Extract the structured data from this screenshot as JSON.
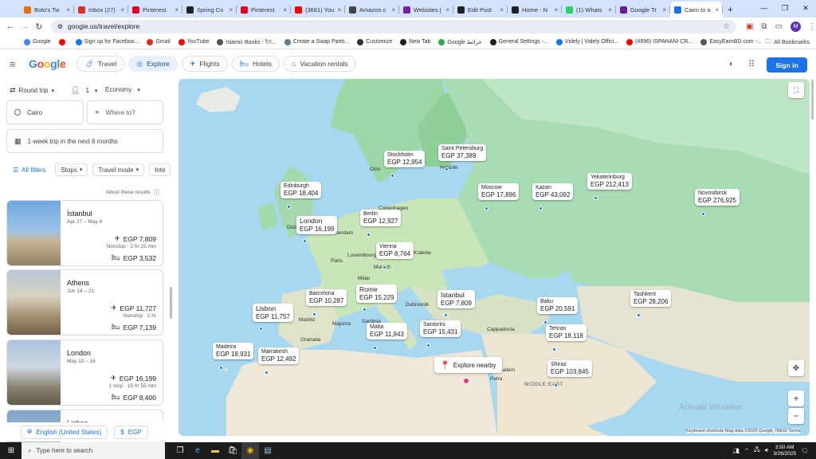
{
  "browser": {
    "tabs": [
      {
        "title": "Bolo's Tw",
        "color": "#e8710a"
      },
      {
        "title": "Inbox (27)",
        "color": "#d93025"
      },
      {
        "title": "Pinterest",
        "color": "#e60023"
      },
      {
        "title": "Spring Co",
        "color": "#202124"
      },
      {
        "title": "Pinterest",
        "color": "#e60023"
      },
      {
        "title": "(3661) You",
        "color": "#ff0000"
      },
      {
        "title": "Amazon.c",
        "color": "#444"
      },
      {
        "title": "Websites |",
        "color": "#7b1fa2"
      },
      {
        "title": "Edit Post",
        "color": "#202124"
      },
      {
        "title": "Home - N",
        "color": "#202124"
      },
      {
        "title": "(1) Whats",
        "color": "#25d366"
      },
      {
        "title": "Google Tr",
        "color": "#6a1b9a"
      },
      {
        "title": "Cairo to a",
        "color": "#1a73e8"
      }
    ],
    "url": "google.us/travel/explore",
    "bookmarks": [
      {
        "label": "Google",
        "color": "#4285f4"
      },
      {
        "label": "",
        "color": "#ff0000"
      },
      {
        "label": "Sign up for Faceboo...",
        "color": "#1877f2"
      },
      {
        "label": "Gmail",
        "color": "#d93025"
      },
      {
        "label": "YouTube",
        "color": "#ff0000"
      },
      {
        "label": "Islamic Books - ইস...",
        "color": "#555"
      },
      {
        "label": "Create a Swap Partit...",
        "color": "#607d8b"
      },
      {
        "label": "Customize",
        "color": "#333"
      },
      {
        "label": "New Tab",
        "color": "#202124"
      },
      {
        "label": "Google خرائط",
        "color": "#34a853"
      },
      {
        "label": "General Settings -...",
        "color": "#202124"
      },
      {
        "label": "Videly | Videly Offici...",
        "color": "#1a73e8"
      },
      {
        "label": "(4696) ISPAHANI CR...",
        "color": "#ff0000"
      },
      {
        "label": "EasyEarnBD.com -...",
        "color": "#555"
      }
    ],
    "all_bookmarks": "All Bookmarks"
  },
  "header": {
    "logo": "Google",
    "nav": [
      {
        "label": "Travel",
        "icon": "travel-icon",
        "selected": false
      },
      {
        "label": "Explore",
        "icon": "explore-icon",
        "selected": true
      },
      {
        "label": "Flights",
        "icon": "flight-icon",
        "selected": false
      },
      {
        "label": "Hotels",
        "icon": "hotel-icon",
        "selected": false
      },
      {
        "label": "Vacation rentals",
        "icon": "home-icon",
        "selected": false
      }
    ],
    "signin": "Sign in"
  },
  "search": {
    "trip_type": "Round trip",
    "passengers": "1",
    "cabin": "Economy",
    "origin": "Cairo",
    "destination_placeholder": "Where to?",
    "duration": "1-week trip in the next 6 months",
    "filters": [
      "All filters",
      "Stops",
      "Travel mode",
      "Inte"
    ],
    "about": "About these results"
  },
  "results": [
    {
      "city": "İstanbul",
      "dates": "Apr 27 – May 4",
      "flight": "EGP 7,809",
      "stops": "Nonstop · 2 hr 25 min",
      "hotel": "EGP 3,532"
    },
    {
      "city": "Athens",
      "dates": "Jun 14 – 21",
      "flight": "EGP 11,727",
      "stops": "Nonstop · 2 hr",
      "hotel": "EGP 7,139"
    },
    {
      "city": "London",
      "dates": "May 10 – 16",
      "flight": "EGP 16,199",
      "stops": "1 stop · 15 hr 55 min",
      "hotel": "EGP 8,400"
    },
    {
      "city": "Lisbon",
      "dates": "",
      "flight": "",
      "stops": "",
      "hotel": ""
    }
  ],
  "footer": {
    "language": "English (United States)",
    "currency": "EGP"
  },
  "map": {
    "pins": [
      {
        "city": "Stockholm",
        "price": "EGP 12,954",
        "big": false
      },
      {
        "city": "Saint Petersburg",
        "price": "EGP 37,389",
        "big": false
      },
      {
        "city": "Edinburgh",
        "price": "EGP 18,404",
        "big": false
      },
      {
        "city": "Moscow",
        "price": "EGP 17,896",
        "big": false
      },
      {
        "city": "Kazan",
        "price": "EGP 43,092",
        "big": false
      },
      {
        "city": "Yekaterinburg",
        "price": "EGP 212,413",
        "big": false
      },
      {
        "city": "Novosibirsk",
        "price": "EGP 276,925",
        "big": false
      },
      {
        "city": "Berlin",
        "price": "EGP 12,927",
        "big": false
      },
      {
        "city": "London",
        "price": "EGP 16,199",
        "big": true
      },
      {
        "city": "Vienna",
        "price": "EGP 8,764",
        "big": false
      },
      {
        "city": "Barcelona",
        "price": "EGP 10,287",
        "big": false
      },
      {
        "city": "Rome",
        "price": "EGP 15,229",
        "big": true
      },
      {
        "city": "İstanbul",
        "price": "EGP 7,809",
        "big": true
      },
      {
        "city": "Lisbon",
        "price": "EGP 11,757",
        "big": true
      },
      {
        "city": "Baku",
        "price": "EGP 20,591",
        "big": false
      },
      {
        "city": "Tashkent",
        "price": "EGP 28,206",
        "big": false
      },
      {
        "city": "Santorini",
        "price": "EGP 15,431",
        "big": false
      },
      {
        "city": "Malta",
        "price": "EGP 11,943",
        "big": false
      },
      {
        "city": "Tehran",
        "price": "EGP 18,118",
        "big": false
      },
      {
        "city": "Madeira",
        "price": "EGP 18,931",
        "big": false
      },
      {
        "city": "Marrakesh",
        "price": "EGP 12,492",
        "big": false
      },
      {
        "city": "Shiraz",
        "price": "EGP 103,845",
        "big": false
      }
    ],
    "labels": [
      "Oslo",
      "Helsinki",
      "Copenhagen",
      "Dublin",
      "Amsterdam",
      "Paris",
      "Luxembourg",
      "Munich",
      "Kraków",
      "Milan",
      "Madrid",
      "Majorca",
      "Sardinia",
      "Granada",
      "Dubrovnik",
      "Cappadocia",
      "Jerusalem",
      "Petra",
      "MIDDLE EAST"
    ],
    "explore_nearby": "Explore nearby",
    "attribution": "Keyboard shortcuts   Map data ©2025 Google, INEGI   Terms",
    "watermark": "Activate Windows"
  },
  "taskbar": {
    "search_placeholder": "Type here to search",
    "time": "3:50 AM",
    "date": "3/26/2025"
  }
}
